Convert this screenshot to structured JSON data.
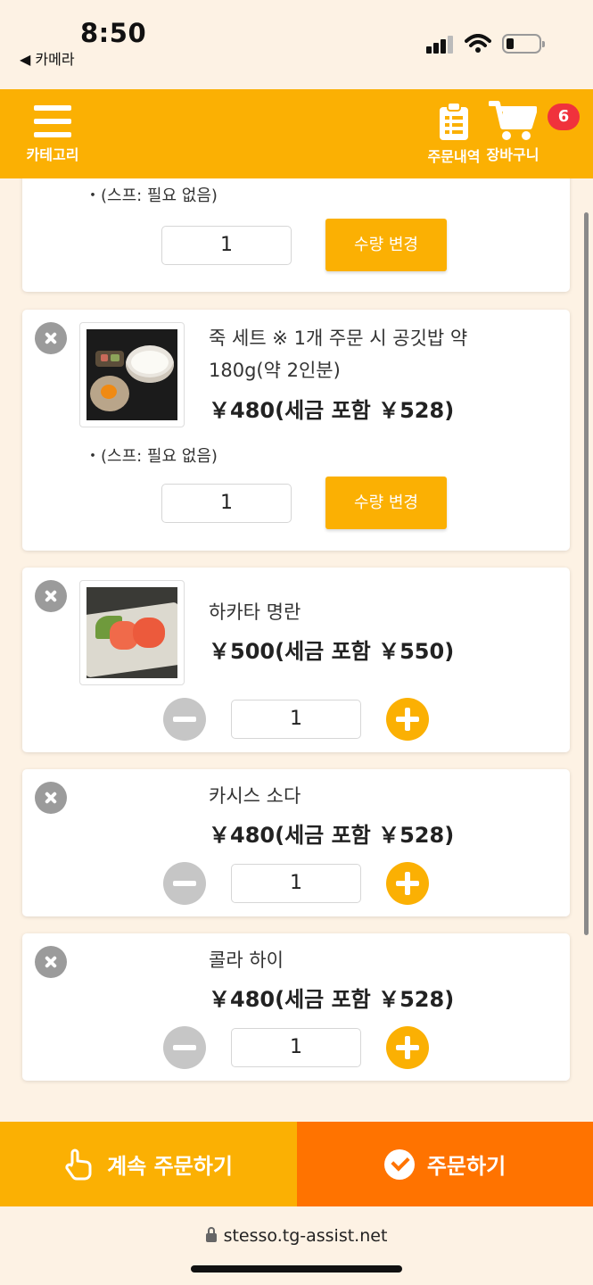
{
  "status_bar": {
    "time": "8:50",
    "back_app": "◀ 카메라"
  },
  "header": {
    "category_label": "카테고리",
    "order_history_label": "주문내역",
    "cart_label": "장바구니",
    "cart_count": "6"
  },
  "cart_items": [
    {
      "name": "",
      "option": "・(스프: 필요 없음)",
      "quantity": "1",
      "qty_change_label": "수량 변경"
    },
    {
      "name": "죽 세트 ※ 1개 주문 시 공깃밥 약 180g(약 2인분)",
      "price": "￥480(세금 포함 ￥528)",
      "option": "・(스프: 필요 없음)",
      "quantity": "1",
      "qty_change_label": "수량 변경",
      "image_icon": "rice-porridge-set-photo"
    },
    {
      "name": "하카타 명란",
      "price": "￥500(세금 포함 ￥550)",
      "quantity": "1",
      "image_icon": "mentaiko-photo"
    },
    {
      "name": "카시스 소다",
      "price": "￥480(세금 포함 ￥528)",
      "quantity": "1"
    },
    {
      "name": "콜라 하이",
      "price": "￥480(세금 포함 ￥528)",
      "quantity": "1"
    }
  ],
  "footer": {
    "continue_label": "계속 주문하기",
    "order_label": "주문하기"
  },
  "browser": {
    "url": "stesso.tg-assist.net"
  },
  "colors": {
    "accent": "#fbb003",
    "order_button": "#ff7300",
    "badge": "#f0323c",
    "background": "#fdf2e4"
  }
}
